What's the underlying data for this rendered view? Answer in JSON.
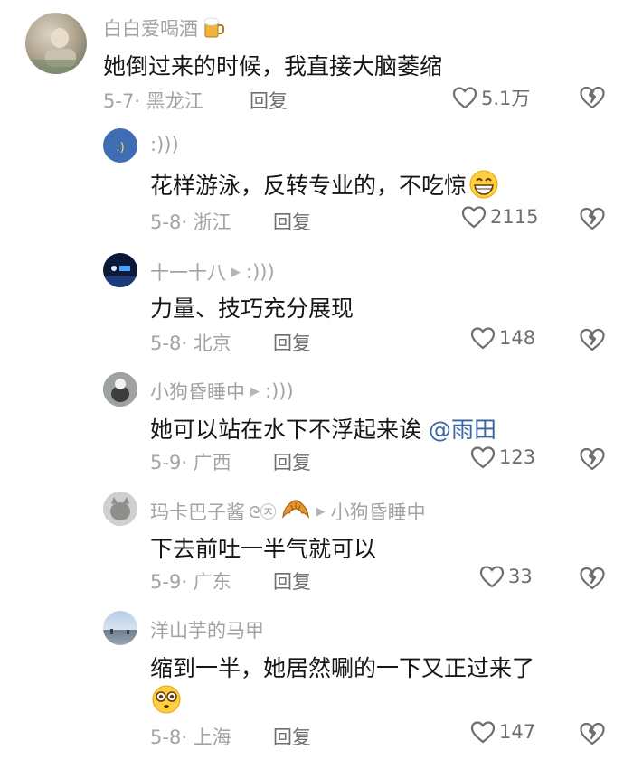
{
  "comments": [
    {
      "username": "白白爱喝酒",
      "emoji_after_name": "beer-mug",
      "text": "她倒过来的时候，我直接大脑萎缩",
      "date": "5-7",
      "location": "黑龙江",
      "reply_label": "回复",
      "likes": "5.1万"
    },
    {
      "username": ":)))",
      "text": "花样游泳，反转专业的，不吃惊",
      "emoji_after_text": "grinning-face",
      "date": "5-8",
      "location": "浙江",
      "reply_label": "回复",
      "likes": "2115"
    },
    {
      "username": "十一十八",
      "reply_to": ":)))",
      "text": "力量、技巧充分展现",
      "date": "5-8",
      "location": "北京",
      "reply_label": "回复",
      "likes": "148"
    },
    {
      "username": "小狗昏睡中",
      "reply_to": ":)))",
      "text": "她可以站在水下不浮起来诶",
      "mention": "@雨田",
      "date": "5-9",
      "location": "广西",
      "reply_label": "回复",
      "likes": "123"
    },
    {
      "username": "玛卡巴子酱",
      "name_decor": "ᘓ㉨",
      "emoji_after_name": "croissant",
      "reply_to": "小狗昏睡中",
      "text": "下去前吐一半气就可以",
      "date": "5-9",
      "location": "广东",
      "reply_label": "回复",
      "likes": "33"
    },
    {
      "username": "洋山芋的马甲",
      "text": "缩到一半，她居然唰的一下又正过来了",
      "emoji_line": "flushed-face",
      "date": "5-8",
      "location": "上海",
      "reply_label": "回复",
      "likes": "147"
    }
  ],
  "colors": {
    "text": "#161616",
    "meta": "#a3a3a3",
    "action": "#6e6e6e",
    "mention": "#3b65a3"
  }
}
